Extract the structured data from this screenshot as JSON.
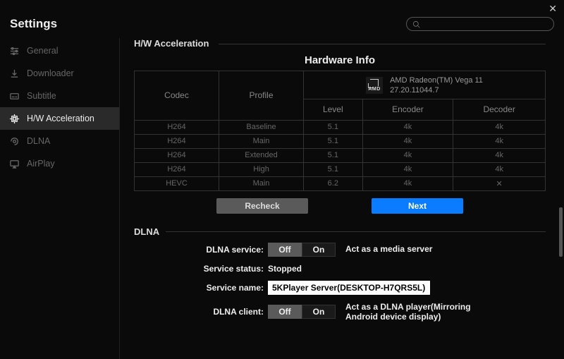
{
  "window": {
    "title": "Settings"
  },
  "search": {
    "placeholder": ""
  },
  "sidebar": {
    "items": [
      {
        "label": "General"
      },
      {
        "label": "Downloader"
      },
      {
        "label": "Subtitle"
      },
      {
        "label": "H/W Acceleration"
      },
      {
        "label": "DLNA"
      },
      {
        "label": "AirPlay"
      }
    ],
    "active_index": 3
  },
  "hw": {
    "section_label": "H/W Acceleration",
    "heading": "Hardware Info",
    "gpu": {
      "brand": "AMD",
      "name": "AMD Radeon(TM) Vega 11",
      "version": "27.20.11044.7"
    },
    "columns": {
      "codec": "Codec",
      "profile": "Profile",
      "level": "Level",
      "encoder": "Encoder",
      "decoder": "Decoder"
    },
    "rows": [
      {
        "codec": "H264",
        "profile": "Baseline",
        "level": "5.1",
        "encoder": "4k",
        "decoder": "4k"
      },
      {
        "codec": "H264",
        "profile": "Main",
        "level": "5.1",
        "encoder": "4k",
        "decoder": "4k"
      },
      {
        "codec": "H264",
        "profile": "Extended",
        "level": "5.1",
        "encoder": "4k",
        "decoder": "4k"
      },
      {
        "codec": "H264",
        "profile": "High",
        "level": "5.1",
        "encoder": "4k",
        "decoder": "4k"
      },
      {
        "codec": "HEVC",
        "profile": "Main",
        "level": "6.2",
        "encoder": "4k",
        "decoder": "✕"
      }
    ],
    "buttons": {
      "recheck": "Recheck",
      "next": "Next"
    }
  },
  "dlna": {
    "section_label": "DLNA",
    "service": {
      "label": "DLNA service:",
      "off": "Off",
      "on": "On",
      "value": "Off",
      "desc": "Act as a media server"
    },
    "status": {
      "label": "Service status:",
      "value": "Stopped"
    },
    "name": {
      "label": "Service name:",
      "value": "5KPlayer Server(DESKTOP-H7QRS5L)"
    },
    "client": {
      "label": "DLNA client:",
      "off": "Off",
      "on": "On",
      "value": "Off",
      "desc1": "Act as a DLNA player(Mirroring",
      "desc2": "Android device display)"
    }
  }
}
